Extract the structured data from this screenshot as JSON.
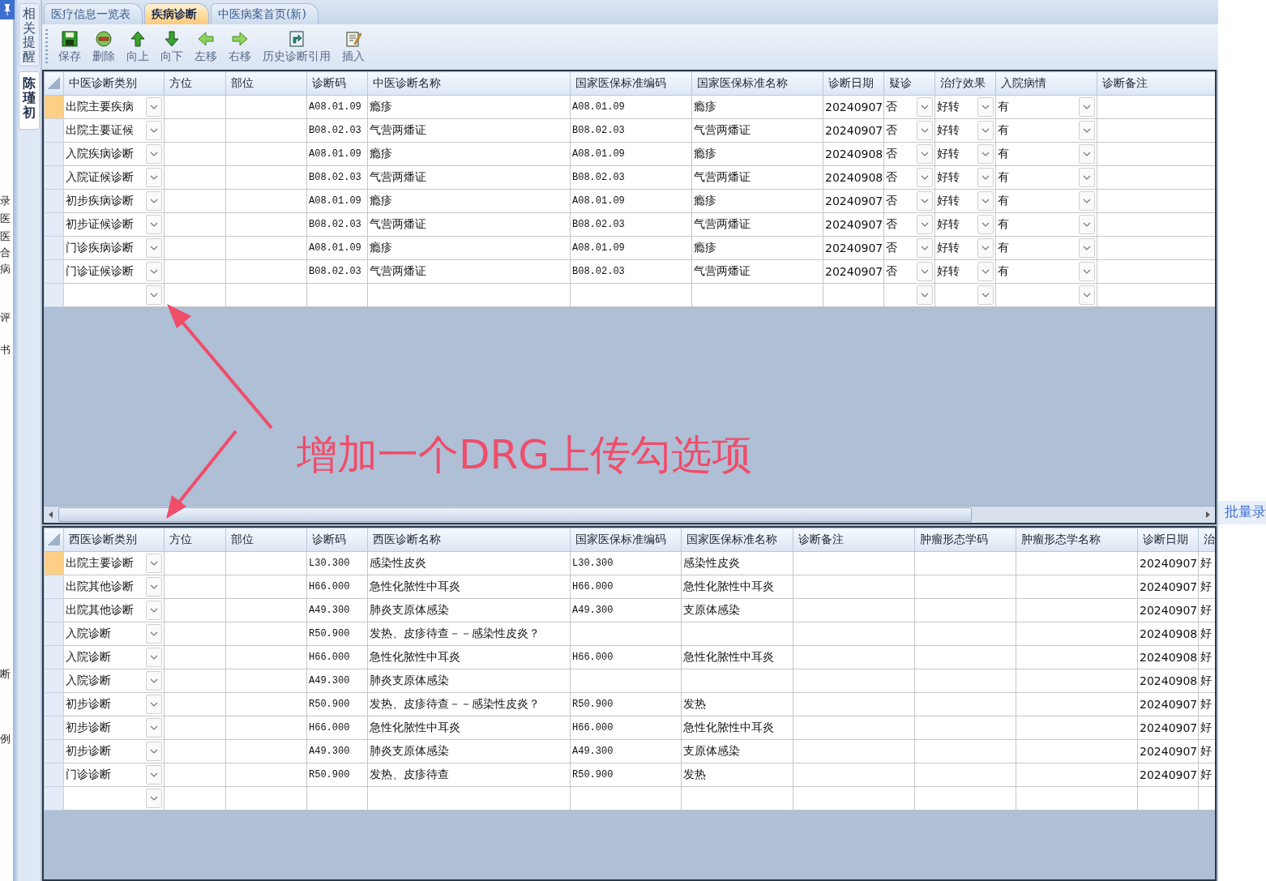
{
  "left_fragments": [
    "录",
    "医",
    "医",
    "合",
    "病",
    "评",
    "书",
    "断",
    "例"
  ],
  "side_tabs": [
    {
      "label": "相关提醒",
      "selected": false
    },
    {
      "label": "陈瑾初",
      "selected": true
    }
  ],
  "tabs": [
    {
      "label": "医疗信息一览表",
      "selected": false
    },
    {
      "label": "疾病诊断",
      "selected": true
    },
    {
      "label": "中医病案首页(新)",
      "selected": false
    }
  ],
  "toolbar": [
    {
      "label": "保存",
      "kind": "save"
    },
    {
      "label": "删除",
      "kind": "delete"
    },
    {
      "label": "向上",
      "kind": "up"
    },
    {
      "label": "向下",
      "kind": "down"
    },
    {
      "label": "左移",
      "kind": "left"
    },
    {
      "label": "右移",
      "kind": "right"
    },
    {
      "label": "历史诊断引用",
      "kind": "history"
    },
    {
      "label": "插入",
      "kind": "insert"
    }
  ],
  "tcm_grid": {
    "columns": [
      {
        "label": "中医诊断类别",
        "kind": "combo"
      },
      {
        "label": "方位",
        "kind": "text"
      },
      {
        "label": "部位",
        "kind": "text"
      },
      {
        "label": "诊断码",
        "kind": "code"
      },
      {
        "label": "中医诊断名称",
        "kind": "text"
      },
      {
        "label": "国家医保标准编码",
        "kind": "code"
      },
      {
        "label": "国家医保标准名称",
        "kind": "text"
      },
      {
        "label": "诊断日期",
        "kind": "text"
      },
      {
        "label": "疑诊",
        "kind": "combo"
      },
      {
        "label": "治疗效果",
        "kind": "combo"
      },
      {
        "label": "入院病情",
        "kind": "combo"
      },
      {
        "label": "诊断备注",
        "kind": "text"
      }
    ],
    "rows": [
      {
        "selected": true,
        "cells": [
          "出院主要疾病",
          null,
          null,
          "A08.01.09",
          "瘾疹",
          "A08.01.09",
          "瘾疹",
          "20240907",
          "否",
          "好转",
          "有",
          null
        ]
      },
      {
        "selected": false,
        "cells": [
          "出院主要证候",
          null,
          null,
          "B08.02.03",
          "气营两燔证",
          "B08.02.03",
          "气营两燔证",
          "20240907",
          "否",
          "好转",
          "有",
          null
        ]
      },
      {
        "selected": false,
        "cells": [
          "入院疾病诊断",
          null,
          null,
          "A08.01.09",
          "瘾疹",
          "A08.01.09",
          "瘾疹",
          "20240908",
          "否",
          "好转",
          "有",
          null
        ]
      },
      {
        "selected": false,
        "cells": [
          "入院证候诊断",
          null,
          null,
          "B08.02.03",
          "气营两燔证",
          "B08.02.03",
          "气营两燔证",
          "20240908",
          "否",
          "好转",
          "有",
          null
        ]
      },
      {
        "selected": false,
        "cells": [
          "初步疾病诊断",
          null,
          null,
          "A08.01.09",
          "瘾疹",
          "A08.01.09",
          "瘾疹",
          "20240907",
          "否",
          "好转",
          "有",
          null
        ]
      },
      {
        "selected": false,
        "cells": [
          "初步证候诊断",
          null,
          null,
          "B08.02.03",
          "气营两燔证",
          "B08.02.03",
          "气营两燔证",
          "20240907",
          "否",
          "好转",
          "有",
          null
        ]
      },
      {
        "selected": false,
        "cells": [
          "门诊疾病诊断",
          null,
          null,
          "A08.01.09",
          "瘾疹",
          "A08.01.09",
          "瘾疹",
          "20240907",
          "否",
          "好转",
          "有",
          null
        ]
      },
      {
        "selected": false,
        "cells": [
          "门诊证候诊断",
          null,
          null,
          "B08.02.03",
          "气营两燔证",
          "B08.02.03",
          "气营两燔证",
          "20240907",
          "否",
          "好转",
          "有",
          null
        ]
      },
      {
        "selected": false,
        "cells": [
          null,
          null,
          null,
          null,
          null,
          null,
          null,
          null,
          null,
          null,
          null,
          null
        ]
      }
    ]
  },
  "annotation": {
    "text": "增加一个DRG上传勾选项"
  },
  "western_grid": {
    "columns": [
      {
        "label": "西医诊断类别",
        "kind": "combo"
      },
      {
        "label": "方位",
        "kind": "text"
      },
      {
        "label": "部位",
        "kind": "text"
      },
      {
        "label": "诊断码",
        "kind": "code"
      },
      {
        "label": "西医诊断名称",
        "kind": "text"
      },
      {
        "label": "国家医保标准编码",
        "kind": "code"
      },
      {
        "label": "国家医保标准名称",
        "kind": "text"
      },
      {
        "label": "诊断备注",
        "kind": "text"
      },
      {
        "label": "肿瘤形态学码",
        "kind": "text"
      },
      {
        "label": "肿瘤形态学名称",
        "kind": "text"
      },
      {
        "label": "诊断日期",
        "kind": "text"
      },
      {
        "label": "治",
        "kind": "text"
      }
    ],
    "rows": [
      {
        "selected": true,
        "cells": [
          "出院主要诊断",
          null,
          null,
          "L30.300",
          "感染性皮炎",
          "L30.300",
          "感染性皮炎",
          null,
          null,
          null,
          "20240907",
          "好"
        ]
      },
      {
        "selected": false,
        "cells": [
          "出院其他诊断",
          null,
          null,
          "H66.000",
          "急性化脓性中耳炎",
          "H66.000",
          "急性化脓性中耳炎",
          null,
          null,
          null,
          "20240907",
          "好"
        ]
      },
      {
        "selected": false,
        "cells": [
          "出院其他诊断",
          null,
          null,
          "A49.300",
          "肺炎支原体感染",
          "A49.300",
          "支原体感染",
          null,
          null,
          null,
          "20240907",
          "好"
        ]
      },
      {
        "selected": false,
        "cells": [
          "入院诊断",
          null,
          null,
          "R50.900",
          "发热、皮疹待查－－感染性皮炎？",
          null,
          null,
          null,
          null,
          null,
          "20240908",
          "好"
        ]
      },
      {
        "selected": false,
        "cells": [
          "入院诊断",
          null,
          null,
          "H66.000",
          "急性化脓性中耳炎",
          "H66.000",
          "急性化脓性中耳炎",
          null,
          null,
          null,
          "20240908",
          "好"
        ]
      },
      {
        "selected": false,
        "cells": [
          "入院诊断",
          null,
          null,
          "A49.300",
          "肺炎支原体感染",
          null,
          null,
          null,
          null,
          null,
          "20240908",
          "好"
        ]
      },
      {
        "selected": false,
        "cells": [
          "初步诊断",
          null,
          null,
          "R50.900",
          "发热、皮疹待查－－感染性皮炎？",
          "R50.900",
          "发热",
          null,
          null,
          null,
          "20240907",
          "好"
        ]
      },
      {
        "selected": false,
        "cells": [
          "初步诊断",
          null,
          null,
          "H66.000",
          "急性化脓性中耳炎",
          "H66.000",
          "急性化脓性中耳炎",
          null,
          null,
          null,
          "20240907",
          "好"
        ]
      },
      {
        "selected": false,
        "cells": [
          "初步诊断",
          null,
          null,
          "A49.300",
          "肺炎支原体感染",
          "A49.300",
          "支原体感染",
          null,
          null,
          null,
          "20240907",
          "好"
        ]
      },
      {
        "selected": false,
        "cells": [
          "门诊诊断",
          null,
          null,
          "R50.900",
          "发热、皮疹待查",
          "R50.900",
          "发热",
          null,
          null,
          null,
          "20240907",
          "好"
        ]
      },
      {
        "selected": false,
        "cells": [
          null,
          null,
          null,
          null,
          null,
          null,
          null,
          null,
          null,
          null,
          null,
          null
        ]
      }
    ]
  },
  "right_panel": {
    "link": "批量录"
  }
}
